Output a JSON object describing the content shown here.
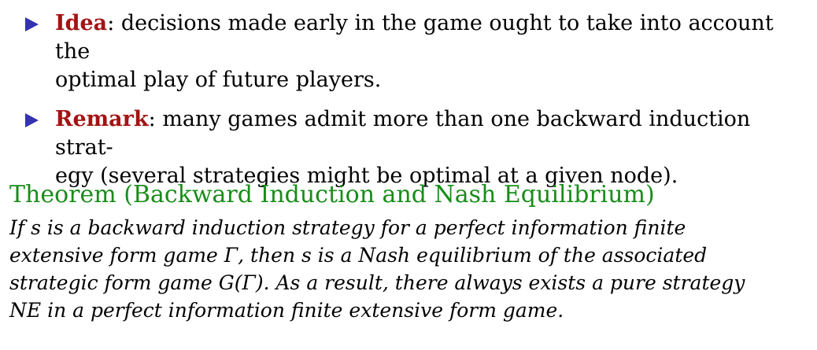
{
  "bullets": [
    {
      "keyword": "Idea",
      "colon": ":",
      "lines": [
        " decisions made early in the game ought to take into account the",
        "optimal play of future players."
      ]
    },
    {
      "keyword": "Remark",
      "colon": ":",
      "lines": [
        " many games admit more than one backward induction strat-",
        "egy (several strategies might be optimal at a given node)."
      ]
    }
  ],
  "theorem": {
    "title": "Theorem (Backward Induction and Nash Equilibrium)",
    "lines": [
      "If s is a backward induction strategy for a perfect information finite",
      "extensive form game Γ, then s is a Nash equilibrium of the associated",
      "strategic form game G(Γ). As a result, there always exists a pure strategy",
      "NE in a perfect information finite extensive form game."
    ]
  },
  "colors": {
    "bullet": "#3333b2",
    "keyword": "#a31414",
    "theorem_title": "#1a8c1a"
  },
  "icons": {
    "bullet": "triangle-right-icon"
  }
}
